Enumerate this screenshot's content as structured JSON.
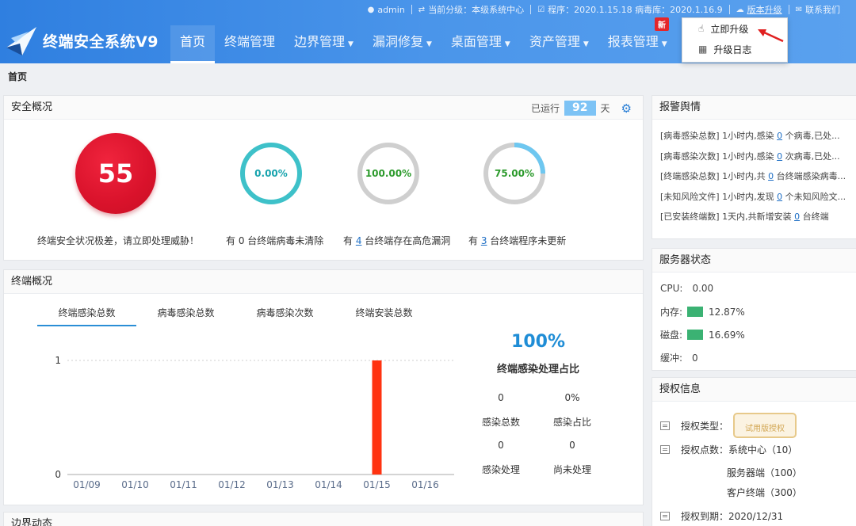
{
  "topbar": {
    "user": "admin",
    "level": "当前分级：本级系统中心",
    "version": "程序：2020.1.15.18  病毒库：2020.1.16.9",
    "upgrade": "版本升级",
    "contact": "联系我们"
  },
  "brand": {
    "name": "终端安全系统V9"
  },
  "nav": [
    {
      "label": "首页",
      "has_caret": false,
      "active": true
    },
    {
      "label": "终端管理",
      "has_caret": false,
      "active": false
    },
    {
      "label": "边界管理",
      "has_caret": true,
      "active": false
    },
    {
      "label": "漏洞修复",
      "has_caret": true,
      "active": false
    },
    {
      "label": "桌面管理",
      "has_caret": true,
      "active": false
    },
    {
      "label": "资产管理",
      "has_caret": true,
      "active": false
    },
    {
      "label": "报表管理",
      "has_caret": true,
      "active": false
    }
  ],
  "new_badge": "新",
  "upgrade_menu": {
    "items": [
      "立即升级",
      "升级日志"
    ]
  },
  "breadcrumb": "首页",
  "overview": {
    "title": "安全概况",
    "running_label": "已运行",
    "running_days": "92",
    "days_unit": "天",
    "score": "55",
    "score_caption": "终端安全状况极差，请立即处理威胁！",
    "rings": [
      {
        "value": "0.00%",
        "fraction": 1.0,
        "color": "#3ec1c9",
        "text_color": "#16a3ad",
        "cap_pre": "有 0 台终端病毒未清除",
        "cap_num": "",
        "cap_post": ""
      },
      {
        "value": "100.00%",
        "fraction": 0.0,
        "color": "#cfcfcf",
        "text_color": "#2c9a2c",
        "cap_pre": "有 ",
        "cap_num": "4",
        "cap_post": " 台终端存在高危漏洞"
      },
      {
        "value": "75.00%",
        "fraction": 0.25,
        "color": "#6ec7f0",
        "text_color": "#2c9a2c",
        "cap_pre": "有 ",
        "cap_num": "3",
        "cap_post": " 台终端程序未更新"
      }
    ]
  },
  "terminal": {
    "title": "终端概况",
    "tabs": [
      "终端感染总数",
      "病毒感染总数",
      "病毒感染次数",
      "终端安装总数"
    ],
    "percent": "100%",
    "percent_caption": "终端感染处理占比",
    "kv": [
      {
        "value": "0",
        "label": "感染总数"
      },
      {
        "value": "0%",
        "label": "感染占比"
      },
      {
        "value": "0",
        "label": "感染处理"
      },
      {
        "value": "0",
        "label": "尚未处理"
      }
    ]
  },
  "chart_data": {
    "type": "bar",
    "categories": [
      "01/09",
      "01/10",
      "01/11",
      "01/12",
      "01/13",
      "01/14",
      "01/15",
      "01/16"
    ],
    "values": [
      0,
      0,
      0,
      0,
      0,
      0,
      1,
      0
    ],
    "ylim": [
      0,
      1
    ],
    "yticks": [
      "0",
      "1"
    ],
    "bar_color": "#ff3311",
    "grid": true
  },
  "border": {
    "title": "边界动态"
  },
  "alarm": {
    "title": "报警舆情",
    "items": [
      {
        "pre": "[病毒感染总数] 1小时内,感染 ",
        "num": "0",
        "post": " 个病毒,已处..."
      },
      {
        "pre": "[病毒感染次数] 1小时内,感染 ",
        "num": "0",
        "post": " 次病毒,已处..."
      },
      {
        "pre": "[终端感染总数] 1小时内,共 ",
        "num": "0",
        "post": " 台终端感染病毒..."
      },
      {
        "pre": "[未知风险文件] 1小时内,发现 ",
        "num": "0",
        "post": " 个未知风险文..."
      },
      {
        "pre": "[已安装终端数] 1天内,共新增安装 ",
        "num": "0",
        "post": " 台终端"
      }
    ]
  },
  "server": {
    "title": "服务器状态",
    "cpu_label": "CPU:",
    "cpu": "0.00",
    "mem_label": "内存:",
    "mem": "12.87%",
    "disk_label": "磁盘:",
    "disk": "16.69%",
    "buffer_label": "缓冲:",
    "buffer": "0"
  },
  "license": {
    "title": "授权信息",
    "type_label": "授权类型：",
    "type_stamp": "试用版授权",
    "points_label": "授权点数：系统中心（10）",
    "server_count": "服务器端（100）",
    "client_count": "客户终端（300）",
    "expire": "授权到期：2020/12/31"
  }
}
